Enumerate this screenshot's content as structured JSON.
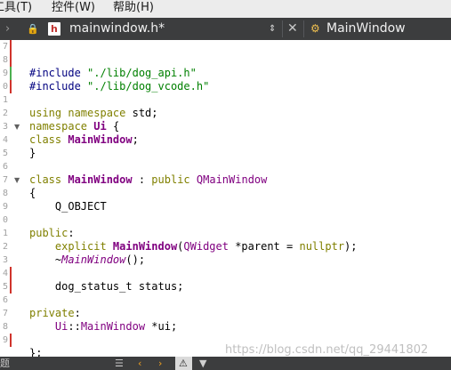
{
  "menu": {
    "tools": "工具(T)",
    "controls": "控件(W)",
    "help": "帮助(H)"
  },
  "toolbar": {
    "nav_icon": "›",
    "lock_icon": "🔒",
    "file_badge": "h",
    "file_name": "mainwindow.h*",
    "updown_icon": "⇕",
    "close_icon": "✕",
    "class_icon": "⚙",
    "class_label": "MainWindow"
  },
  "editor": {
    "lines": [
      {
        "num": "7"
      },
      {
        "num": "8"
      },
      {
        "num": "9"
      },
      {
        "num": "0"
      },
      {
        "num": "1"
      },
      {
        "num": "2"
      },
      {
        "num": "3"
      },
      {
        "num": "4"
      },
      {
        "num": "5"
      },
      {
        "num": "6"
      },
      {
        "num": "7"
      },
      {
        "num": "8"
      },
      {
        "num": "9"
      },
      {
        "num": "0"
      },
      {
        "num": "1"
      },
      {
        "num": "2"
      },
      {
        "num": "3"
      },
      {
        "num": "4"
      },
      {
        "num": "5"
      },
      {
        "num": "6"
      },
      {
        "num": "7"
      },
      {
        "num": "8"
      },
      {
        "num": "9"
      }
    ],
    "code": {
      "l3a": "#include ",
      "l3b": "\"./lib/dog_api.h\"",
      "l4a": "#include ",
      "l4b": "\"./lib/dog_vcode.h\"",
      "l6a": "using namespace",
      "l6b": " std;",
      "l7a": "namespace",
      "l7b": " Ui",
      "l7c": " {",
      "l8a": "class",
      "l8b": "MainWindow",
      "l8c": ";",
      "l9": "}",
      "l11a": "class",
      "l11b": "MainWindow",
      "l11c": " : ",
      "l11d": "public",
      "l11e": "QMainWindow",
      "l12": "{",
      "l13": "    Q_OBJECT",
      "l15a": "public",
      "l15b": ":",
      "l16a": "    explicit ",
      "l16b": "MainWindow",
      "l16c": "(",
      "l16d": "QWidget",
      "l16e": " *parent = ",
      "l16f": "nullptr",
      "l16g": ");",
      "l17a": "    ~",
      "l17b": "MainWindow",
      "l17c": "();",
      "l19": "    dog_status_t status;",
      "l21a": "private",
      "l21b": ":",
      "l22a": "    Ui",
      "l22b": "::",
      "l22c": "MainWindow",
      "l22d": " *ui;",
      "l24": "};"
    }
  },
  "statusbar": {
    "left": "题",
    "list_icon": "☰",
    "prev_icon": "‹",
    "next_icon": "›",
    "warn_icon": "⚠",
    "filter_icon": "▼"
  },
  "watermark": "https://blog.csdn.net/qq_29441802",
  "colors": {
    "toolbar_bg": "#3c3d3e",
    "keyword": "#808000",
    "type": "#800080",
    "string": "#008000",
    "directive": "#000080",
    "change_mark": "#d0342c",
    "saved_mark": "#4caf50"
  }
}
